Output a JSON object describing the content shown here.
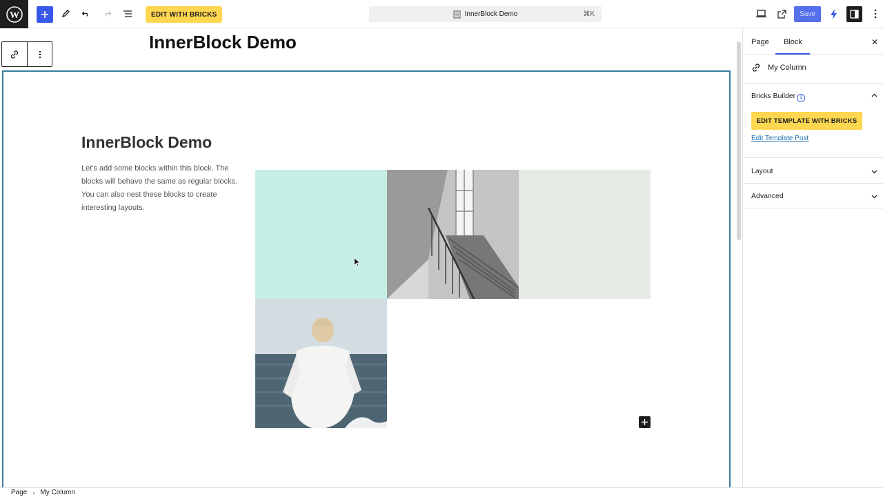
{
  "topbar": {
    "bricks_button": "EDIT WITH BRICKS",
    "document_title": "InnerBlock Demo",
    "shortcut": "⌘K",
    "save_label": "Save"
  },
  "editor": {
    "post_title": "InnerBlock Demo",
    "inner_heading": "InnerBlock Demo",
    "inner_paragraph": "Let's add some blocks within this block. The blocks will behave the same as regular blocks. You can also nest these blocks to create interesting layouts."
  },
  "sidebar": {
    "tabs": [
      "Page",
      "Block"
    ],
    "active_tab": "Block",
    "block_name": "My Column",
    "panels": {
      "bricks": {
        "title": "Bricks Builder",
        "button": "EDIT TEMPLATE WITH BRICKS",
        "link": "Edit Template Post"
      },
      "layout": "Layout",
      "advanced": "Advanced"
    }
  },
  "breadcrumb": [
    "Page",
    "My Column"
  ],
  "colors": {
    "accent": "#3858e9",
    "bricks_yellow": "#ffd64f",
    "selection_border": "#3a7ba0",
    "mint_cell": "#c6eee6",
    "pale_cell": "#e4ece4"
  }
}
